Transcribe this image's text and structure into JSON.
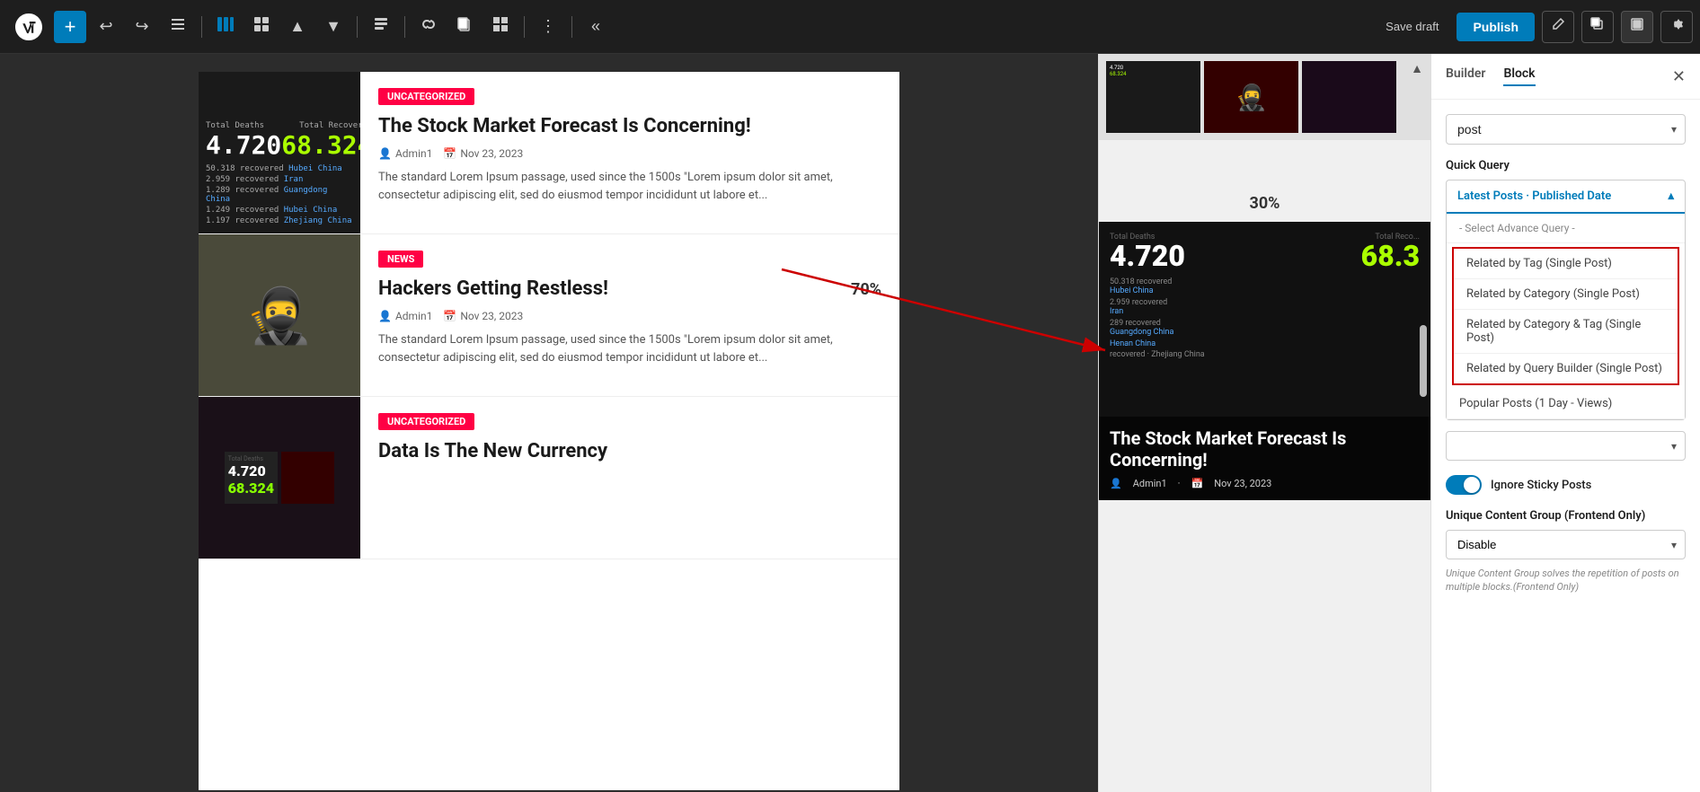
{
  "toolbar": {
    "add_label": "+",
    "save_draft_label": "Save draft",
    "publish_label": "Publish",
    "collapse_label": "«"
  },
  "sidebar": {
    "tab_builder": "Builder",
    "tab_block": "Block",
    "post_type_value": "post",
    "quick_query_label": "Quick Query",
    "quick_query_selected": "Latest Posts · Published Date",
    "advance_query_placeholder": "- Select Advance Query -",
    "dropdown_options": [
      {
        "id": "adv_header",
        "label": "- Select Advance Query -",
        "type": "header"
      },
      {
        "id": "related_tag",
        "label": "Related by Tag (Single Post)",
        "type": "highlighted"
      },
      {
        "id": "related_category",
        "label": "Related by Category (Single Post)",
        "type": "highlighted"
      },
      {
        "id": "related_cat_tag",
        "label": "Related by Category & Tag (Single Post)",
        "type": "highlighted"
      },
      {
        "id": "related_query_builder",
        "label": "Related by Query Builder (Single Post)",
        "type": "highlighted"
      },
      {
        "id": "popular_posts",
        "label": "Popular Posts (1 Day - Views)",
        "type": "popular"
      }
    ],
    "popular_select_placeholder": "",
    "ignore_sticky_label": "Ignore Sticky Posts",
    "ucg_label": "Unique Content Group (Frontend Only)",
    "ucg_value": "Disable",
    "ucg_helper": "Unique Content Group solves the repetition of posts on multiple blocks.(Frontend Only)"
  },
  "posts": [
    {
      "id": 1,
      "category": "Uncategorized",
      "title": "The Stock Market Forecast Is Concerning!",
      "author": "Admin1",
      "date": "Nov 23, 2023",
      "excerpt": "The standard Lorem Ipsum passage, used since the 1500s \"Lorem ipsum dolor sit amet, consectetur adipiscing elit, sed do eiusmod tempor incididunt ut labore et...",
      "thumb_type": "covid"
    },
    {
      "id": 2,
      "category": "News",
      "title": "Hackers Getting Restless!",
      "author": "Admin1",
      "date": "Nov 23, 2023",
      "excerpt": "The standard Lorem Ipsum passage, used since the 1500s \"Lorem ipsum dolor sit amet, consectetur adipiscing elit, sed do eiusmod tempor incididunt ut labore et...",
      "percent": "70%",
      "thumb_type": "hacker"
    },
    {
      "id": 3,
      "category": "Uncategorized",
      "title": "Data Is The New Currency",
      "author": "",
      "date": "",
      "excerpt": "",
      "thumb_type": "data"
    }
  ],
  "preview": {
    "progress_30": "30%",
    "big_title": "The Stock Market Forecast Is Concerning!",
    "big_author": "Admin1",
    "big_date": "Nov 23, 2023",
    "total_deaths_label": "Total Deaths",
    "total_recovered_label": "Total Recovered",
    "deaths_number": "4.720",
    "recovered_number": "68.3",
    "stat1": "50.318 recovered · Hubei China",
    "stat2": "2.959 recovered · Iran",
    "stat3": "289 recovered · Guangdong China",
    "stat4": "Henan China",
    "stat5": "recovered · Zhejiang China"
  },
  "icons": {
    "undo": "↩",
    "redo": "↪",
    "list": "≡",
    "columns": "⊞",
    "block_nav": "⊟",
    "up": "▲",
    "down": "▼",
    "align": "▬",
    "link": "∞",
    "copy": "⧉",
    "grid": "⊞",
    "more": "⋮",
    "collapse": "«",
    "edit": "✏",
    "duplicate": "⧉",
    "fullscreen": "⊡",
    "settings": "⚙",
    "chevron_down": "▾",
    "chevron_up": "▴",
    "close": "✕",
    "person": "👤",
    "calendar": "📅"
  }
}
